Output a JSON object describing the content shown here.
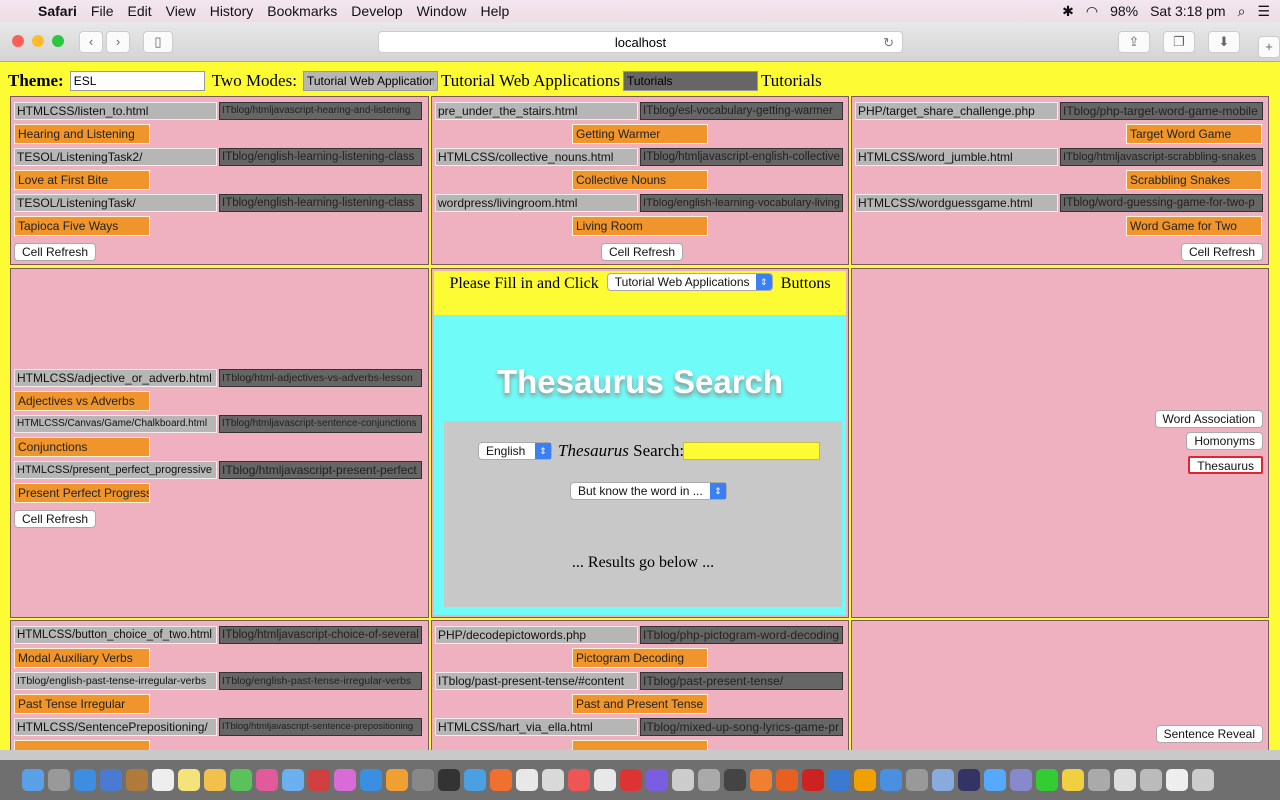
{
  "menubar": {
    "app": "Safari",
    "items": [
      "File",
      "Edit",
      "View",
      "History",
      "Bookmarks",
      "Develop",
      "Window",
      "Help"
    ],
    "battery": "98%",
    "clock": "Sat 3:18 pm"
  },
  "browser": {
    "url": "localhost"
  },
  "theme": {
    "label": "Theme:",
    "value": "ESL",
    "modes_label": "Two Modes:",
    "mode1_value": "Tutorial Web Applications",
    "mode1_text": "Tutorial Web Applications",
    "mode2_value": "Tutorials",
    "mode2_text": "Tutorials"
  },
  "cell_refresh": "Cell Refresh",
  "cells": [
    {
      "align": "left",
      "rows": [
        [
          "HTMLCSS/listen_to.html",
          "ITblog/htmljavascript-hearing-and-listening",
          "Hearing and Listening"
        ],
        [
          "TESOL/ListeningTask2/",
          "ITblog/english-learning-listening-class",
          "Love at First Bite"
        ],
        [
          "TESOL/ListeningTask/",
          "ITblog/english-learning-listening-class",
          "Tapioca Five Ways"
        ]
      ]
    },
    {
      "align": "center",
      "rows": [
        [
          "pre_under_the_stairs.html",
          "ITblog/esl-vocabulary-getting-warmer",
          "Getting Warmer"
        ],
        [
          "HTMLCSS/collective_nouns.html",
          "ITblog/htmljavascript-english-collective",
          "Collective Nouns"
        ],
        [
          "wordpress/livingroom.html",
          "ITblog/english-learning-vocabulary-living",
          "Living Room"
        ]
      ]
    },
    {
      "align": "right",
      "rows": [
        [
          "PHP/target_share_challenge.php",
          "ITblog/php-target-word-game-mobile",
          "Target Word Game"
        ],
        [
          "HTMLCSS/word_jumble.html",
          "ITblog/htmljavascript-scrabbling-snakes",
          "Scrabbling Snakes"
        ],
        [
          "HTMLCSS/wordguessgame.html",
          "ITblog/word-guessing-game-for-two-p",
          "Word Game for Two"
        ]
      ]
    },
    {
      "align": "left",
      "rows": [
        [
          "HTMLCSS/adjective_or_adverb.html",
          "ITblog/html-adjectives-vs-adverbs-lesson",
          "Adjectives vs Adverbs"
        ],
        [
          "HTMLCSS/Canvas/Game/Chalkboard.html",
          "ITblog/htmljavascript-sentence-conjunctions",
          "Conjunctions"
        ],
        [
          "HTMLCSS/present_perfect_progressive",
          "ITblog/htmljavascript-present-perfect",
          "Present Perfect Progressive"
        ]
      ]
    },
    {
      "align": "left",
      "rows": [
        [
          "HTMLCSS/button_choice_of_two.html",
          "ITblog/htmljavascript-choice-of-several",
          "Modal Auxiliary Verbs"
        ],
        [
          "ITblog/english-past-tense-irregular-verbs",
          "ITblog/english-past-tense-irregular-verbs",
          "Past Tense Irregular"
        ],
        [
          "HTMLCSS/SentencePrepositioning/",
          "ITblog/htmljavascript-sentence-prepositioning",
          ""
        ]
      ]
    },
    {
      "align": "center",
      "rows": [
        [
          "PHP/decodepictowords.php",
          "ITblog/php-pictogram-word-decoding",
          "Pictogram Decoding"
        ],
        [
          "ITblog/past-present-tense/#content",
          "ITblog/past-present-tense/",
          "Past and Present Tense"
        ],
        [
          "HTMLCSS/hart_via_ella.html",
          "ITblog/mixed-up-song-lyrics-game-pr",
          ""
        ]
      ]
    }
  ],
  "center": {
    "prompt": "Please Fill in and Click",
    "select": "Tutorial Web Applications",
    "suffix": "Buttons",
    "title": "Thesaurus Search",
    "lang": "English",
    "search_italic": "Thesaurus",
    "search_label": " Search:",
    "search_value": "",
    "know_select": "But know the word in ...",
    "results": "... Results go below ..."
  },
  "right_mid": [
    "Word Association",
    "Homonyms",
    "Thesaurus"
  ],
  "right_bottom": [
    "Sentence Reveal"
  ],
  "colors": {
    "page": "#fdfb33",
    "cell": "#efb0c0",
    "orange": "#f0952b",
    "cyan": "#6ffcf8",
    "selected_border": "#e0262d"
  }
}
